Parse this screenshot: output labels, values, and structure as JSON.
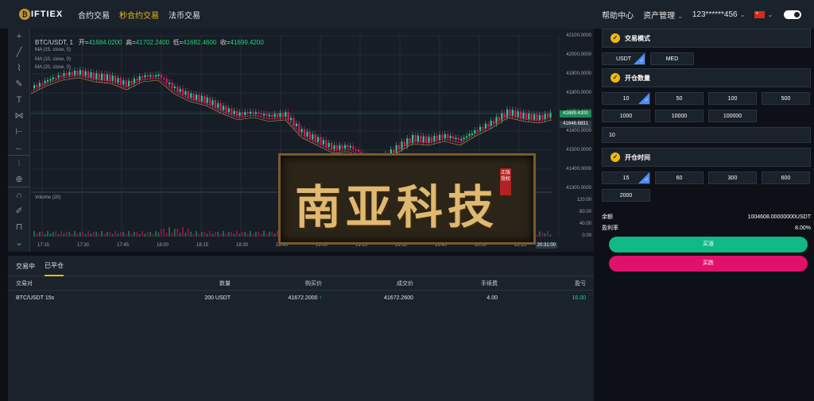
{
  "topbar": {
    "logo_text": "IFTIEX",
    "nav": [
      "合约交易",
      "秒合约交易",
      "法币交易"
    ],
    "help": "帮助中心",
    "assets": "资产管理",
    "account": "123******456"
  },
  "chart": {
    "symbol": "BTC/USDT, 1",
    "open_label": "开=",
    "open": "41684.0200",
    "high_label": "高=",
    "high": "41702.2400",
    "low_label": "低=",
    "low": "41682.4600",
    "close_label": "收=",
    "close": "41699.4200",
    "ma1": "MA (15, close, 0)",
    "ma2": "MA (10, close, 0)",
    "ma3": "MA (20, close, 0)",
    "volume": "Volume (20)",
    "price_ticks": [
      "42100.0000",
      "42000.0000",
      "41900.0000",
      "41800.0000",
      "41700.0000",
      "41600.0000",
      "41500.0000",
      "41400.0000",
      "41300.0000"
    ],
    "current_price": "41699.4200",
    "ma_price": "41646.6831",
    "volume_ticks": [
      "120.00",
      "80.00",
      "40.00",
      "0.00"
    ],
    "time_ticks": [
      "17:15",
      "17:30",
      "17:45",
      "18:00",
      "18:15",
      "18:30",
      "18:45",
      "19:00",
      "19:15",
      "19:30",
      "19:45",
      "20:00",
      "20:15"
    ],
    "time_end": "20:31:00"
  },
  "watermark": {
    "text": "南亚科技",
    "seal": "正版授权"
  },
  "orders": {
    "tabs": [
      "交易中",
      "已平仓"
    ],
    "headers": [
      "交易对",
      "数量",
      "购买价",
      "成交价",
      "手续费",
      "盈亏"
    ],
    "rows": [
      [
        "BTC/USDT 15s",
        "200 USDT",
        "41672.2000",
        "41672.2600",
        "4.00",
        "16.00"
      ]
    ]
  },
  "panel": {
    "mode_title": "交易模式",
    "modes": [
      "USDT",
      "MED"
    ],
    "qty_title": "开仓数量",
    "qtys": [
      "10",
      "50",
      "100",
      "500",
      "1000",
      "10000",
      "100000"
    ],
    "amount_value": "10",
    "time_title": "开仓时间",
    "times": [
      "15",
      "60",
      "300",
      "600",
      "2000"
    ],
    "balance_label": "余额",
    "balance_value": "1004608.00000000USDT",
    "rate_label": "盈利率",
    "rate_value": "8.00%",
    "buy_label": "买涨",
    "sell_label": "买跌"
  },
  "colors": {
    "up": "#26d07c",
    "down": "#e0116b",
    "accent": "#f0b90b"
  }
}
